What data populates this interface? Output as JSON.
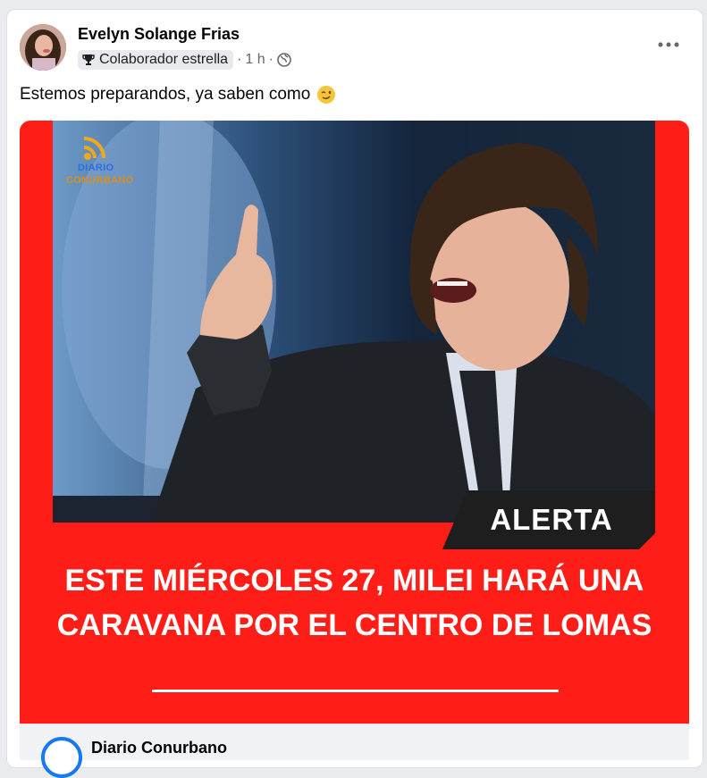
{
  "post": {
    "author": "Evelyn Solange Frias",
    "badge": "Colaborador estrella",
    "time": "1 h",
    "separator": "·",
    "caption": "Estemos preparandos, ya saben como",
    "caption_emoji": "winking-face-emoji",
    "more_icon": "more-options-icon"
  },
  "media": {
    "logo_line1": "DIARIO",
    "logo_line2": "CONURBANO",
    "alert": "ALERTA",
    "headline": "ESTE MIÉRCOLES 27, MILEI HARÁ UNA CARAVANA POR EL CENTRO DE LOMAS",
    "bg_color": "#ff1e17"
  },
  "link_preview": {
    "source": "Diario Conurbano"
  }
}
